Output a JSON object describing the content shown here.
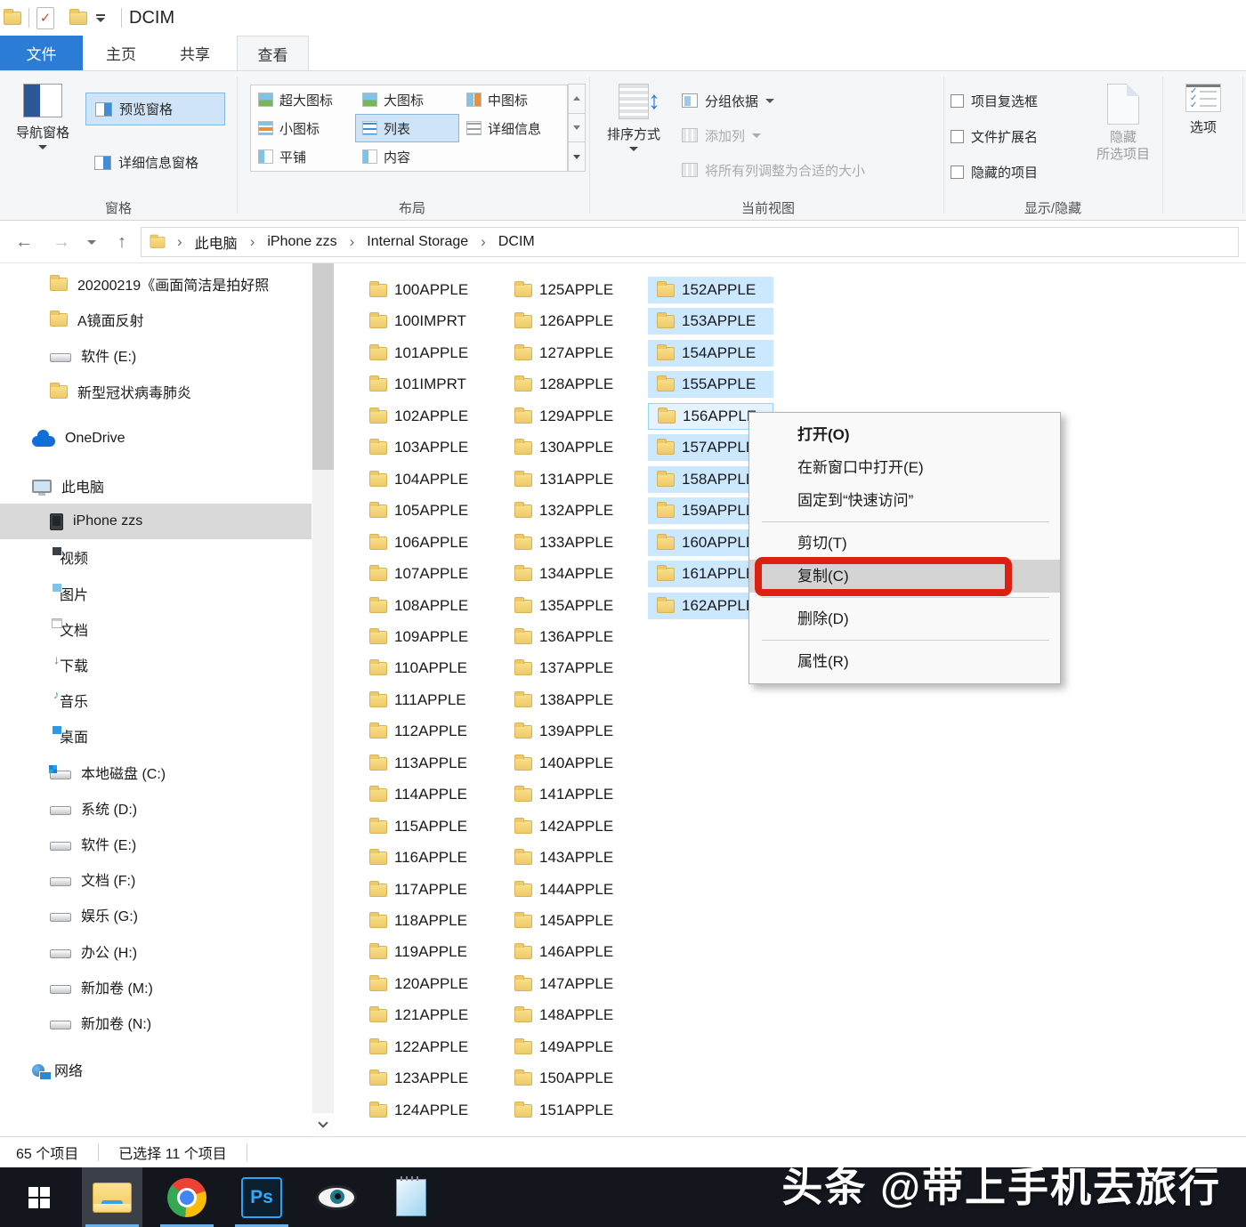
{
  "window": {
    "title": "DCIM"
  },
  "quick_access": {
    "icons": [
      "folder-icon",
      "properties-check-icon",
      "folder-icon"
    ]
  },
  "tabs": [
    {
      "label": "文件",
      "style": "file"
    },
    {
      "label": "主页"
    },
    {
      "label": "共享"
    },
    {
      "label": "查看",
      "active": true
    }
  ],
  "ribbon": {
    "panes": {
      "group_label": "窗格",
      "nav_label": "导航窗格",
      "preview_label": "预览窗格",
      "details_label": "详细信息窗格"
    },
    "layout": {
      "group_label": "布局",
      "items": [
        {
          "label": "超大图标",
          "icon": "g-xl"
        },
        {
          "label": "大图标",
          "icon": "g-lg"
        },
        {
          "label": "中图标",
          "icon": "g-md"
        },
        {
          "label": "小图标",
          "icon": "g-sm"
        },
        {
          "label": "列表",
          "icon": "g-list",
          "selected": true
        },
        {
          "label": "详细信息",
          "icon": "g-det"
        },
        {
          "label": "平铺",
          "icon": "g-tile"
        },
        {
          "label": "内容",
          "icon": "g-cont"
        }
      ]
    },
    "current_view": {
      "group_label": "当前视图",
      "sort_label": "排序方式",
      "group_by_label": "分组依据",
      "add_columns_label": "添加列",
      "size_columns_label": "将所有列调整为合适的大小"
    },
    "show_hide": {
      "group_label": "显示/隐藏",
      "checkboxes": [
        "项目复选框",
        "文件扩展名",
        "隐藏的项目"
      ],
      "hide_selected_line1": "隐藏",
      "hide_selected_line2": "所选项目"
    },
    "options": {
      "options_label": "选项"
    }
  },
  "navigation_bar": {
    "breadcrumb": [
      "此电脑",
      "iPhone zzs",
      "Internal Storage",
      "DCIM"
    ]
  },
  "sidebar": {
    "items": [
      {
        "label": "20200219《画面简洁是拍好照",
        "icon": "i-folder",
        "indent": 2
      },
      {
        "label": "A镜面反射",
        "icon": "i-folder",
        "indent": 2
      },
      {
        "label": "软件 (E:)",
        "icon": "i-drive",
        "indent": 2
      },
      {
        "label": "新型冠状病毒肺炎",
        "icon": "i-folder",
        "indent": 2
      },
      {
        "label": "OneDrive",
        "icon": "i-cloud",
        "indent": 1,
        "section_gap": true
      },
      {
        "label": "此电脑",
        "icon": "i-computer",
        "indent": 1,
        "section_gap": true
      },
      {
        "label": "iPhone zzs",
        "icon": "i-phone",
        "indent": 2,
        "selected": true
      },
      {
        "label": "视频",
        "icon": "i-folder-video",
        "indent": 2
      },
      {
        "label": "图片",
        "icon": "i-folder-picture",
        "indent": 2
      },
      {
        "label": "文档",
        "icon": "i-folder-doc",
        "indent": 2
      },
      {
        "label": "下载",
        "icon": "i-folder-download",
        "indent": 2
      },
      {
        "label": "音乐",
        "icon": "i-folder-music",
        "indent": 2
      },
      {
        "label": "桌面",
        "icon": "i-folder-desktop",
        "indent": 2
      },
      {
        "label": "本地磁盘 (C:)",
        "icon": "i-drive-windows",
        "indent": 2
      },
      {
        "label": "系统 (D:)",
        "icon": "i-drive",
        "indent": 2
      },
      {
        "label": "软件 (E:)",
        "icon": "i-drive",
        "indent": 2
      },
      {
        "label": "文档 (F:)",
        "icon": "i-drive",
        "indent": 2
      },
      {
        "label": "娱乐 (G:)",
        "icon": "i-drive",
        "indent": 2
      },
      {
        "label": "办公 (H:)",
        "icon": "i-drive",
        "indent": 2
      },
      {
        "label": "新加卷 (M:)",
        "icon": "i-drive",
        "indent": 2
      },
      {
        "label": "新加卷 (N:)",
        "icon": "i-drive",
        "indent": 2
      },
      {
        "label": "网络",
        "icon": "i-network",
        "indent": 1,
        "section_gap": true
      }
    ]
  },
  "file_list": {
    "columns": [
      [
        "100APPLE",
        "100IMPRT",
        "101APPLE",
        "101IMPRT",
        "102APPLE",
        "103APPLE",
        "104APPLE",
        "105APPLE",
        "106APPLE",
        "107APPLE",
        "108APPLE",
        "109APPLE",
        "110APPLE",
        "111APPLE",
        "112APPLE",
        "113APPLE",
        "114APPLE",
        "115APPLE",
        "116APPLE",
        "117APPLE",
        "118APPLE",
        "119APPLE",
        "120APPLE",
        "121APPLE",
        "122APPLE",
        "123APPLE",
        "124APPLE"
      ],
      [
        "125APPLE",
        "126APPLE",
        "127APPLE",
        "128APPLE",
        "129APPLE",
        "130APPLE",
        "131APPLE",
        "132APPLE",
        "133APPLE",
        "134APPLE",
        "135APPLE",
        "136APPLE",
        "137APPLE",
        "138APPLE",
        "139APPLE",
        "140APPLE",
        "141APPLE",
        "142APPLE",
        "143APPLE",
        "144APPLE",
        "145APPLE",
        "146APPLE",
        "147APPLE",
        "148APPLE",
        "149APPLE",
        "150APPLE",
        "151APPLE"
      ],
      [
        "152APPLE",
        "153APPLE",
        "154APPLE",
        "155APPLE",
        "156APPLE",
        "157APPLE",
        "158APPLE",
        "159APPLE",
        "160APPLE",
        "161APPLE",
        "162APPLE"
      ]
    ],
    "selected_column": 2,
    "focused_item": "156APPLE"
  },
  "context_menu": {
    "items": [
      {
        "label": "打开(O)",
        "bold": true
      },
      {
        "label": "在新窗口中打开(E)"
      },
      {
        "label": "固定到“快速访问”"
      },
      {
        "separator": true
      },
      {
        "label": "剪切(T)"
      },
      {
        "label": "复制(C)",
        "highlighted": true,
        "annotated": true
      },
      {
        "separator": true
      },
      {
        "label": "删除(D)"
      },
      {
        "separator": true
      },
      {
        "label": "属性(R)"
      }
    ]
  },
  "status_bar": {
    "items_count": "65 个项目",
    "selected_count": "已选择 11 个项目"
  },
  "taskbar": {
    "apps": [
      {
        "icon": "windows-start-icon",
        "active": false,
        "running": false
      },
      {
        "icon": "file-explorer-icon",
        "active": true,
        "running": true
      },
      {
        "icon": "chrome-icon",
        "active": false,
        "running": true
      },
      {
        "icon": "photoshop-icon",
        "active": false,
        "running": true,
        "glyph": "Ps"
      },
      {
        "icon": "image-viewer-eye-icon",
        "active": false,
        "running": false
      },
      {
        "icon": "notepad-icon",
        "active": false,
        "running": false
      }
    ],
    "watermark": "头条 @带上手机去旅行"
  },
  "colors": {
    "file_tab_blue": "#2b7cd6",
    "selection_blue": "#cce8ff",
    "ribbon_highlight": "#cfe4f8",
    "menu_highlight": "#d4d4d4",
    "annotation_red": "#de2012",
    "sidebar_selected_gray": "#d9d9d9",
    "taskbar_dark": "#14161d",
    "taskbar_underline": "#6cb2e8"
  }
}
